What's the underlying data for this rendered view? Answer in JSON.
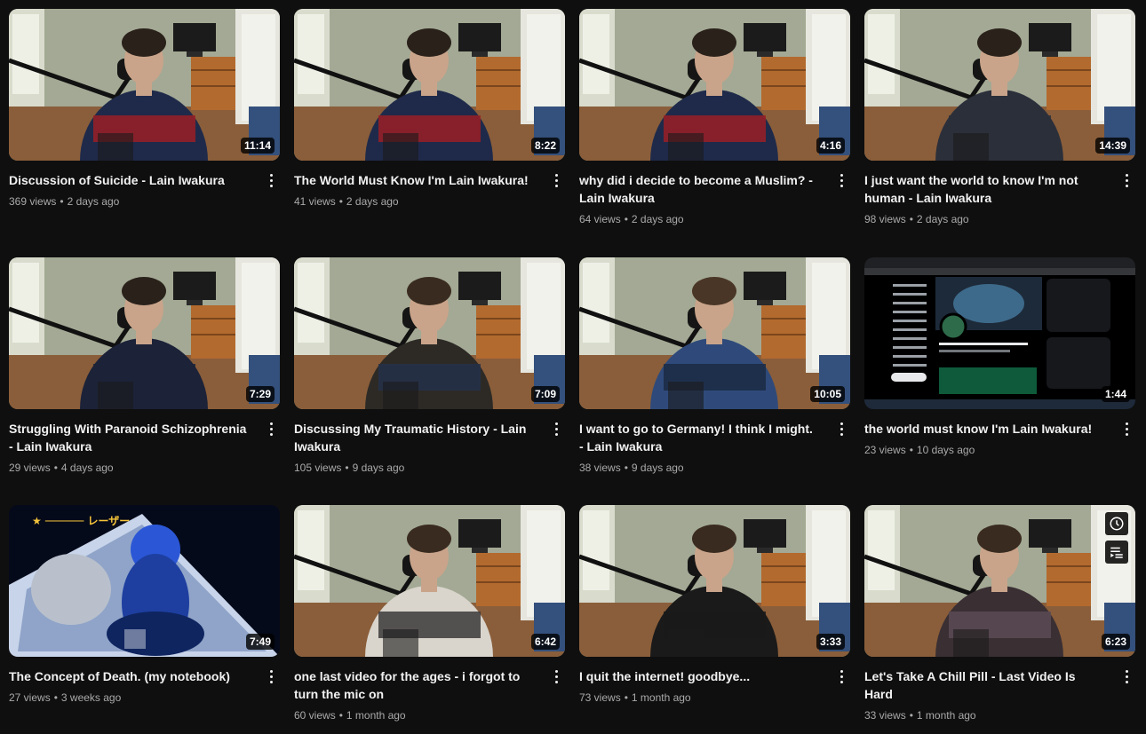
{
  "videos": [
    {
      "title": "Discussion of Suicide - Lain Iwakura",
      "views": "369 views",
      "age": "2 days ago",
      "duration": "11:14",
      "thumb": "hoodie"
    },
    {
      "title": "The World Must Know I'm Lain Iwakura!",
      "views": "41 views",
      "age": "2 days ago",
      "duration": "8:22",
      "thumb": "hoodie"
    },
    {
      "title": "why did i decide to become a Muslim? - Lain Iwakura",
      "views": "64 views",
      "age": "2 days ago",
      "duration": "4:16",
      "thumb": "hoodie"
    },
    {
      "title": "I just want the world to know I'm not human - Lain Iwakura",
      "views": "98 views",
      "age": "2 days ago",
      "duration": "14:39",
      "thumb": "tshirt"
    },
    {
      "title": "Struggling With Paranoid Schizophrenia - Lain Iwakura",
      "views": "29 views",
      "age": "4 days ago",
      "duration": "7:29",
      "thumb": "dark"
    },
    {
      "title": "Discussing My Traumatic History - Lain Iwakura",
      "views": "105 views",
      "age": "9 days ago",
      "duration": "7:09",
      "thumb": "jacket"
    },
    {
      "title": "I want to go to Germany! I think I might. - Lain Iwakura",
      "views": "38 views",
      "age": "9 days ago",
      "duration": "10:05",
      "thumb": "plaid"
    },
    {
      "title": "the world must know I'm Lain Iwakura!",
      "views": "23 views",
      "age": "10 days ago",
      "duration": "1:44",
      "thumb": "screen"
    },
    {
      "title": "The Concept of Death. (my notebook)",
      "views": "27 views",
      "age": "3 weeks ago",
      "duration": "7:49",
      "thumb": "anime"
    },
    {
      "title": "one last video for the ages - i forgot to turn the mic on",
      "views": "60 views",
      "age": "1 month ago",
      "duration": "6:42",
      "thumb": "flannel"
    },
    {
      "title": "I quit the internet! goodbye...",
      "views": "73 views",
      "age": "1 month ago",
      "duration": "3:33",
      "thumb": "black"
    },
    {
      "title": "Let's Take A Chill Pill - Last Video Is Hard",
      "views": "33 views",
      "age": "1 month ago",
      "duration": "6:23",
      "thumb": "flannel2",
      "hover": true
    }
  ],
  "icons": {
    "more": "more-vert-icon",
    "watch_later": "clock-icon",
    "add_to_queue": "queue-icon"
  },
  "colors": {
    "background": "#0f0f0f",
    "title": "#f1f1f1",
    "meta": "#aaaaaa"
  }
}
